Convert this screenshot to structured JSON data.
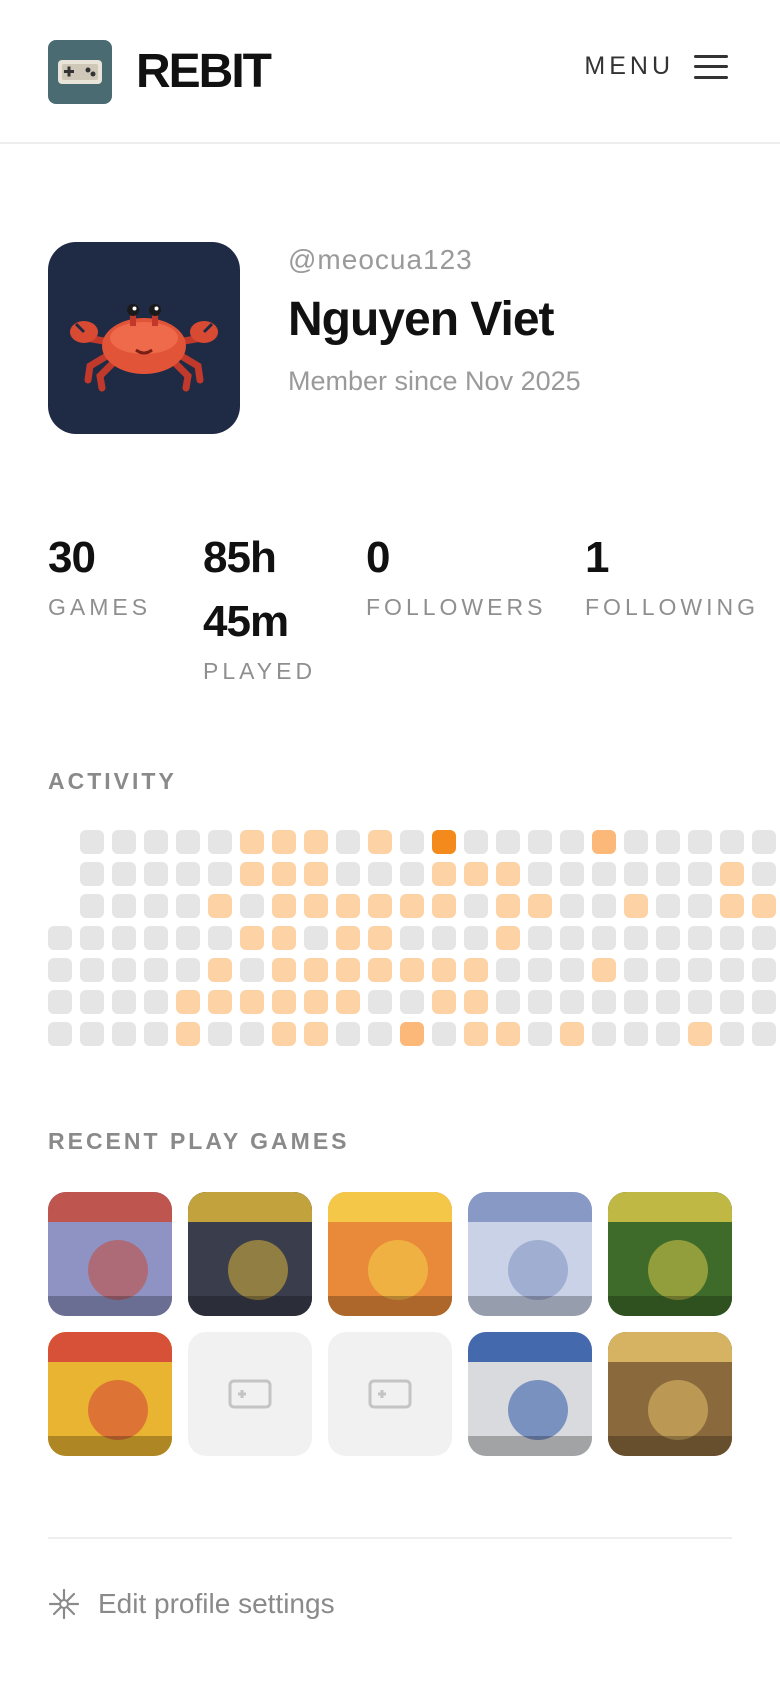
{
  "header": {
    "brand": "REBIT",
    "menu_label": "MENU",
    "logo_icon": "gamepad-icon"
  },
  "profile": {
    "handle": "@meocua123",
    "name": "Nguyen Viet",
    "member_since": "Member since Nov 2025",
    "avatar": "crab-avatar"
  },
  "stats": {
    "games_value": "30",
    "games_label": "GAMES",
    "played_value_line1": "85h",
    "played_value_line2": "45m",
    "played_label": "PLAYED",
    "followers_value": "0",
    "followers_label": "FOLLOWERS",
    "following_value": "1",
    "following_label": "FOLLOWING"
  },
  "activity": {
    "title": "ACTIVITY",
    "colors": {
      "0": "#e5e5e5",
      "1": "#fdd3a6",
      "2": "#fcb878",
      "3": "#f58a1c"
    },
    "rows": [
      [
        -1,
        0,
        0,
        0,
        0,
        0,
        1,
        1,
        1,
        0,
        1,
        0,
        3,
        0,
        0,
        0,
        0,
        2,
        0,
        0,
        0,
        0,
        0
      ],
      [
        -1,
        0,
        0,
        0,
        0,
        0,
        1,
        1,
        1,
        0,
        0,
        0,
        1,
        1,
        1,
        0,
        0,
        0,
        0,
        0,
        0,
        1,
        0
      ],
      [
        -1,
        0,
        0,
        0,
        0,
        1,
        0,
        1,
        1,
        1,
        1,
        1,
        1,
        0,
        1,
        1,
        0,
        0,
        1,
        0,
        0,
        1,
        1
      ],
      [
        0,
        0,
        0,
        0,
        0,
        0,
        1,
        1,
        0,
        1,
        1,
        0,
        0,
        0,
        1,
        0,
        0,
        0,
        0,
        0,
        0,
        0,
        0
      ],
      [
        0,
        0,
        0,
        0,
        0,
        1,
        0,
        1,
        1,
        1,
        1,
        1,
        1,
        1,
        0,
        0,
        0,
        1,
        0,
        0,
        0,
        0,
        0
      ],
      [
        0,
        0,
        0,
        0,
        1,
        1,
        1,
        1,
        1,
        1,
        0,
        0,
        1,
        1,
        0,
        0,
        0,
        0,
        0,
        0,
        0,
        0,
        0
      ],
      [
        0,
        0,
        0,
        0,
        1,
        0,
        0,
        1,
        1,
        0,
        0,
        2,
        0,
        1,
        1,
        0,
        1,
        0,
        0,
        0,
        1,
        0,
        0
      ]
    ]
  },
  "recent": {
    "title": "RECENT PLAY GAMES",
    "games": [
      {
        "name": "game-contra",
        "empty": false,
        "bg": "#8e93c4",
        "accent": "#c74a3b"
      },
      {
        "name": "game-advance-wars-2",
        "empty": false,
        "bg": "#3a3d4c",
        "accent": "#d9b43a"
      },
      {
        "name": "game-pokemon-firered",
        "empty": false,
        "bg": "#e98a3a",
        "accent": "#f6d14b"
      },
      {
        "name": "game-pokemon-soulsilver",
        "empty": false,
        "bg": "#c9d2e6",
        "accent": "#7e8fc0"
      },
      {
        "name": "game-secret-of-mana",
        "empty": false,
        "bg": "#3f6b2a",
        "accent": "#d7c64a"
      },
      {
        "name": "game-kirby-super-star",
        "empty": false,
        "bg": "#e8b431",
        "accent": "#d43f3a"
      },
      {
        "name": "game-placeholder",
        "empty": true
      },
      {
        "name": "game-placeholder",
        "empty": true
      },
      {
        "name": "game-metal-gear",
        "empty": false,
        "bg": "#d8dadd",
        "accent": "#2b55a5"
      },
      {
        "name": "game-metal-slug-x",
        "empty": false,
        "bg": "#8a6a3c",
        "accent": "#e3c069"
      }
    ]
  },
  "settings": {
    "label": "Edit profile settings",
    "icon": "sparkle-icon"
  }
}
